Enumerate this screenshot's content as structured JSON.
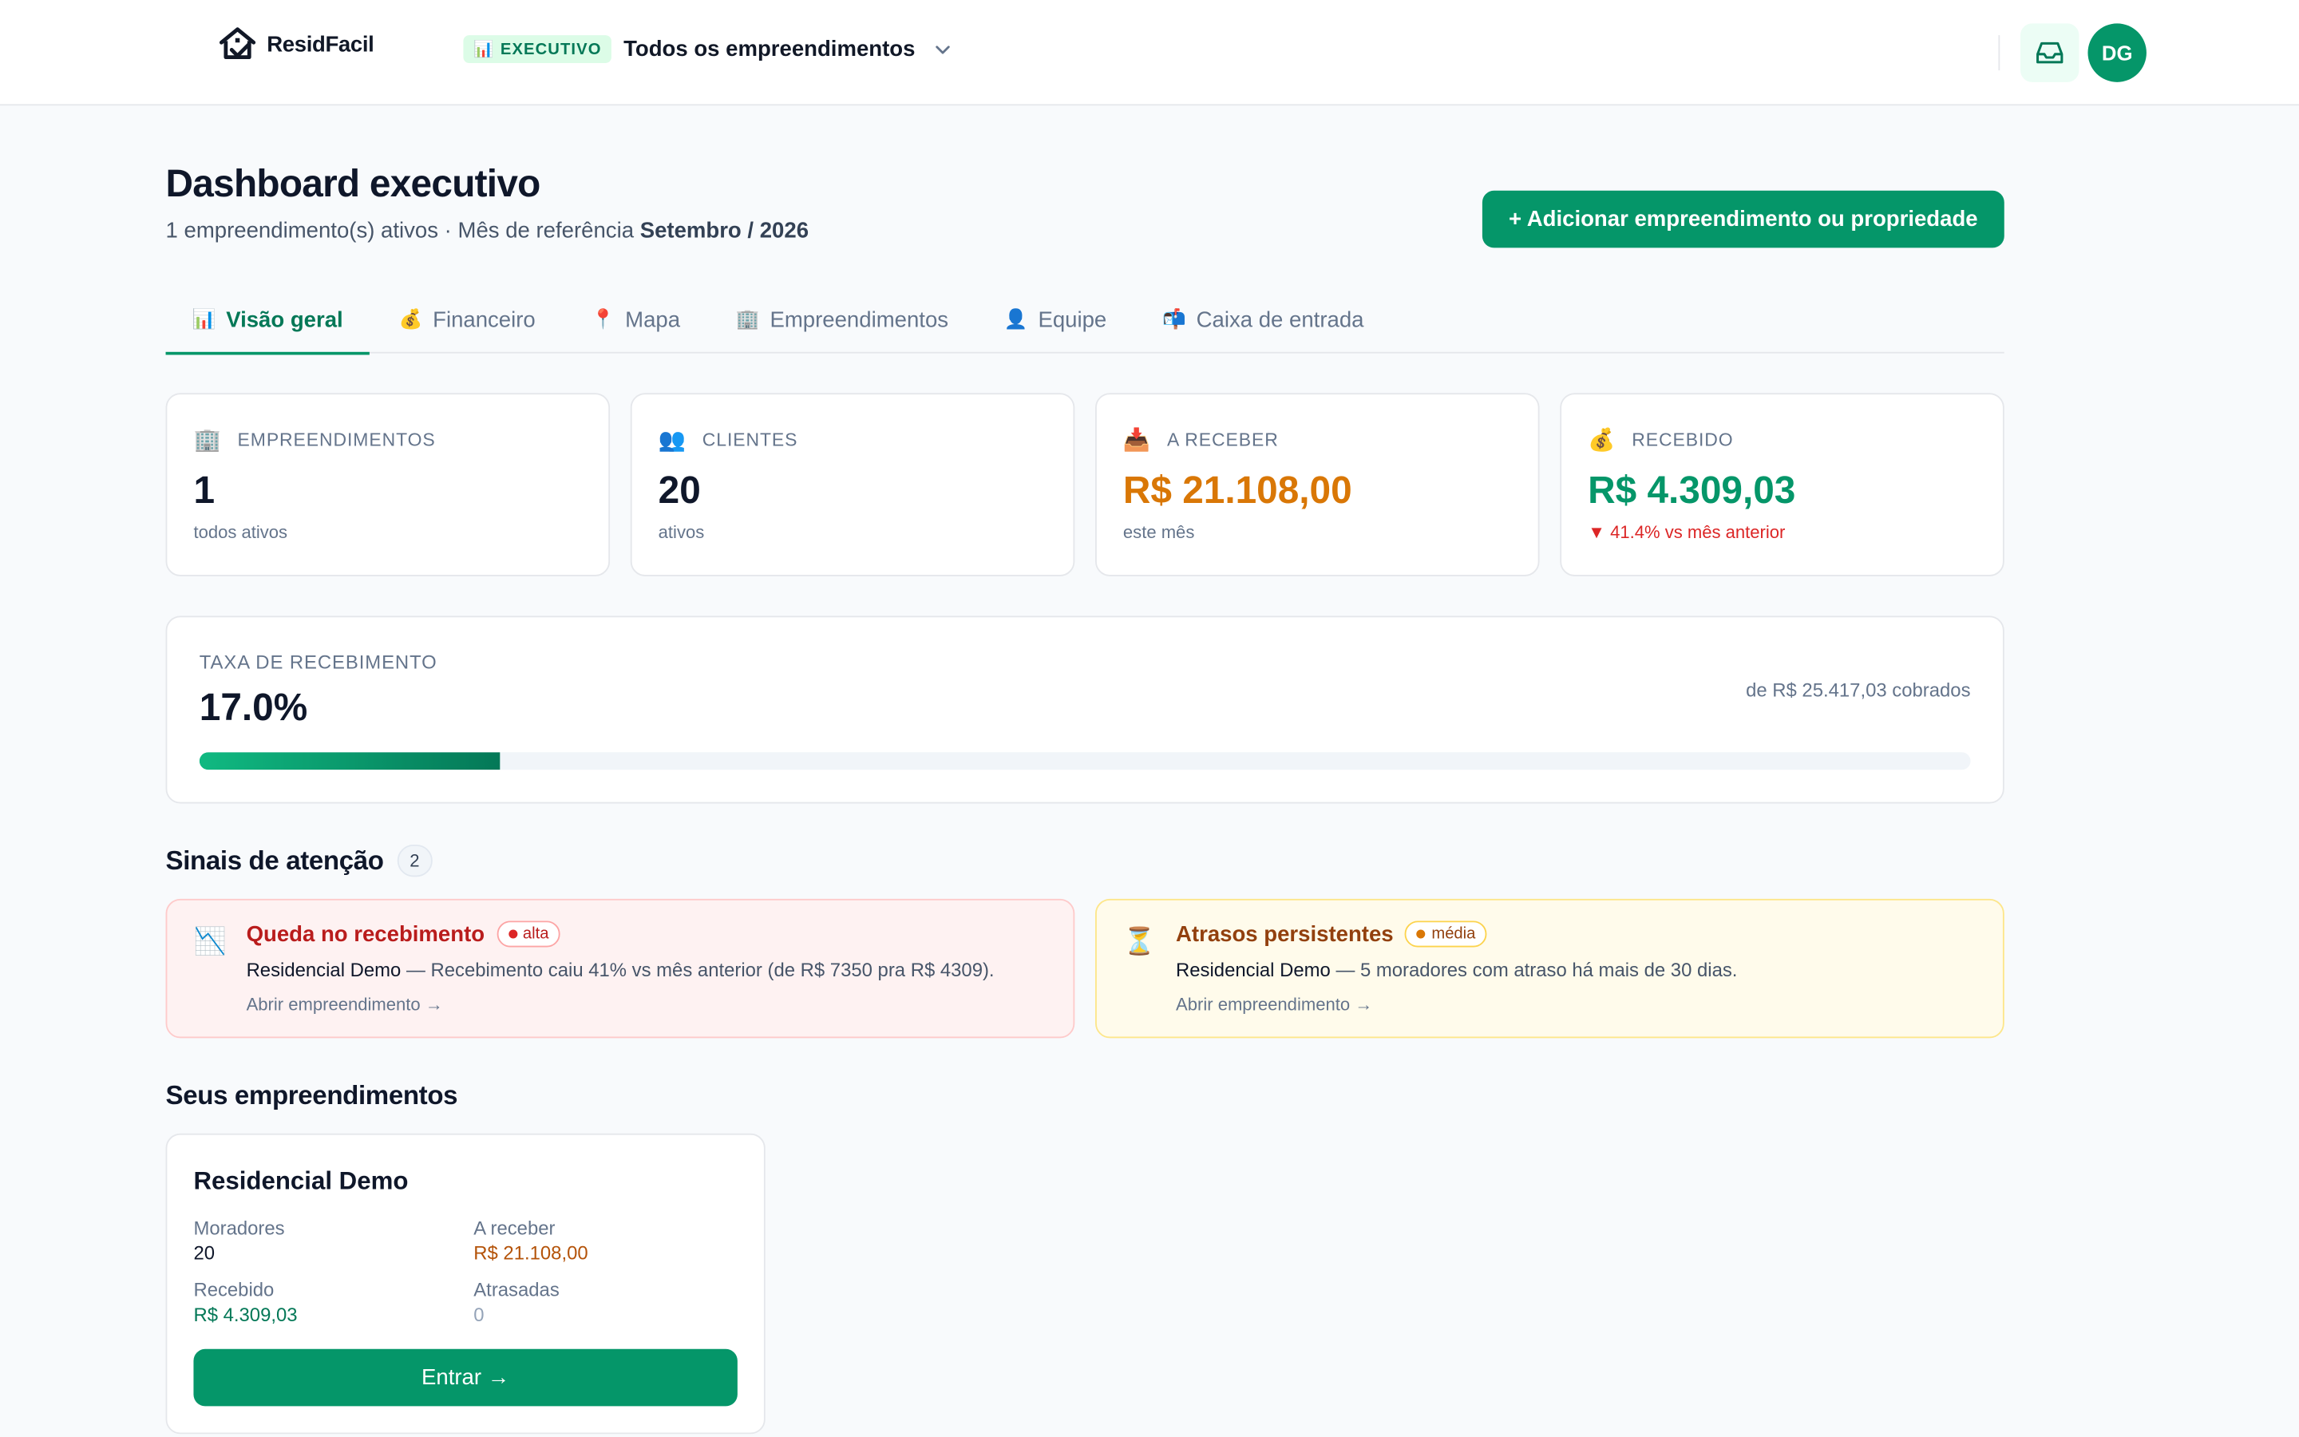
{
  "brand": {
    "name": "ResidFacil"
  },
  "scope": {
    "badge": "EXECUTIVO",
    "badge_icon": "📊",
    "title": "Todos os empreendimentos"
  },
  "avatar": {
    "initials": "DG"
  },
  "header": {
    "title": "Dashboard executivo",
    "subtitle_prefix": "1 empreendimento(s) ativos · Mês de referência ",
    "reference_month": "Setembro / 2026",
    "add_button": "+ Adicionar empreendimento ou propriedade"
  },
  "tabs": [
    {
      "icon": "📊",
      "label": "Visão geral"
    },
    {
      "icon": "💰",
      "label": "Financeiro"
    },
    {
      "icon": "📍",
      "label": "Mapa"
    },
    {
      "icon": "🏢",
      "label": "Empreendimentos"
    },
    {
      "icon": "👤",
      "label": "Equipe"
    },
    {
      "icon": "📬",
      "label": "Caixa de entrada"
    }
  ],
  "kpis": [
    {
      "icon": "🏢",
      "label": "EMPREENDIMENTOS",
      "value": "1",
      "foot": "todos ativos"
    },
    {
      "icon": "👥",
      "label": "CLIENTES",
      "value": "20",
      "foot": "ativos"
    },
    {
      "icon": "📥",
      "label": "A RECEBER",
      "value": "R$ 21.108,00",
      "foot": "este mês"
    },
    {
      "icon": "💰",
      "label": "RECEBIDO",
      "value": "R$ 4.309,03",
      "foot": "▼ 41.4% vs mês anterior"
    }
  ],
  "rate": {
    "label": "TAXA DE RECEBIMENTO",
    "value": "17.0%",
    "progress_percent": 17,
    "note": "de R$ 25.417,03 cobrados"
  },
  "attention": {
    "title": "Sinais de atenção",
    "count": "2",
    "alerts": [
      {
        "icon": "📉",
        "title": "Queda no recebimento",
        "severity": "alta",
        "entity": "Residencial Demo",
        "text": " — Recebimento caiu 41% vs mês anterior (de R$ 7350 pra R$ 4309).",
        "link": "Abrir empreendimento →"
      },
      {
        "icon": "⏳",
        "title": "Atrasos persistentes",
        "severity": "média",
        "entity": "Residencial Demo",
        "text": " — 5 moradores com atraso há mais de 30 dias.",
        "link": "Abrir empreendimento →"
      }
    ]
  },
  "properties": {
    "title": "Seus empreendimentos",
    "items": [
      {
        "name": "Residencial Demo",
        "moradores_label": "Moradores",
        "moradores": "20",
        "receber_label": "A receber",
        "receber": "R$ 21.108,00",
        "recebido_label": "Recebido",
        "recebido": "R$ 4.309,03",
        "atrasadas_label": "Atrasadas",
        "atrasadas": "0",
        "button": "Entrar →"
      }
    ]
  },
  "colors": {
    "accent": "#059669",
    "warning": "#d97706",
    "danger": "#dc2626"
  }
}
